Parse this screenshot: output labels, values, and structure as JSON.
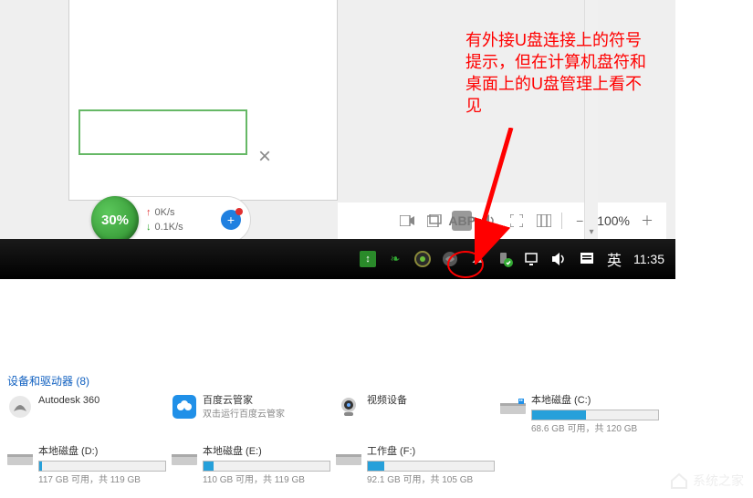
{
  "annotation": {
    "text": "有外接U盘连接上的符号提示，但在计算机盘符和桌面上的U盘管理上看不见"
  },
  "speed": {
    "percent": "30%",
    "up": "0K/s",
    "down": "0.1K/s"
  },
  "toolbar": {
    "zoom": "100%",
    "minus": "−",
    "plus": "＋"
  },
  "taskbar": {
    "ime": "英",
    "time": "11:35"
  },
  "explorer": {
    "header": "设备和驱动器 (8)",
    "devices": [
      {
        "name": "Autodesk 360",
        "sub": ""
      },
      {
        "name": "百度云管家",
        "sub": "双击运行百度云管家"
      },
      {
        "name": "视频设备",
        "sub": ""
      },
      {
        "name_prefix": "本地磁盘 (C:)",
        "free": "68.6 GB 可用，共 120 GB",
        "fill": 43
      },
      {
        "name_prefix": "本地磁盘 (D:)",
        "free": "117 GB 可用，共 119 GB",
        "fill": 2
      },
      {
        "name_prefix": "本地磁盘 (E:)",
        "free": "110 GB 可用，共 119 GB",
        "fill": 8
      },
      {
        "name_prefix": "工作盘 (F:)",
        "free": "92.1 GB 可用，共 105 GB",
        "fill": 13
      }
    ]
  },
  "watermark": "系统之家"
}
